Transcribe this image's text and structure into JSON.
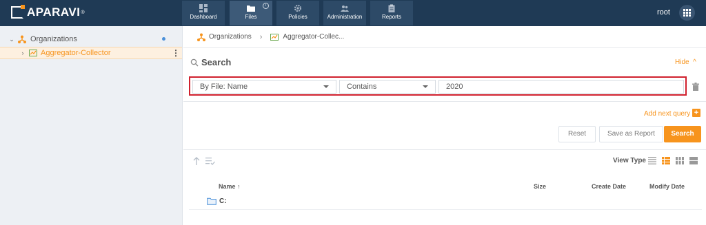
{
  "brand": {
    "name": "APARAVI",
    "reg": "®",
    "accent": "#f7941d",
    "header_bg": "#1f3a55"
  },
  "nav": {
    "tabs": [
      {
        "label": "Dashboard",
        "icon": "dashboard-icon"
      },
      {
        "label": "Files",
        "icon": "folder-icon",
        "active": true,
        "badge_icon": "info-icon"
      },
      {
        "label": "Policies",
        "icon": "gear-icon"
      },
      {
        "label": "Administration",
        "icon": "users-icon"
      },
      {
        "label": "Reports",
        "icon": "clipboard-icon"
      }
    ],
    "user": "root",
    "apps_icon": "apps-grid-icon"
  },
  "sidebar": {
    "items": [
      {
        "label": "Organizations",
        "icon": "organization-icon",
        "expanded": true
      },
      {
        "label": "Aggregator-Collector",
        "icon": "aggregator-icon",
        "selected": true
      }
    ]
  },
  "breadcrumb": {
    "items": [
      "Organizations",
      "Aggregator-Collec..."
    ]
  },
  "search": {
    "title": "Search",
    "hide_label": "Hide",
    "query": {
      "field": "By File: Name",
      "operator": "Contains",
      "value": "2020"
    },
    "add_next_label": "Add next query",
    "buttons": {
      "reset": "Reset",
      "save": "Save as Report",
      "search": "Search"
    }
  },
  "results": {
    "view_type_label": "View Type",
    "columns": [
      "Name",
      "Size",
      "Create Date",
      "Modify Date"
    ],
    "rows": [
      {
        "name": "C:"
      }
    ]
  }
}
